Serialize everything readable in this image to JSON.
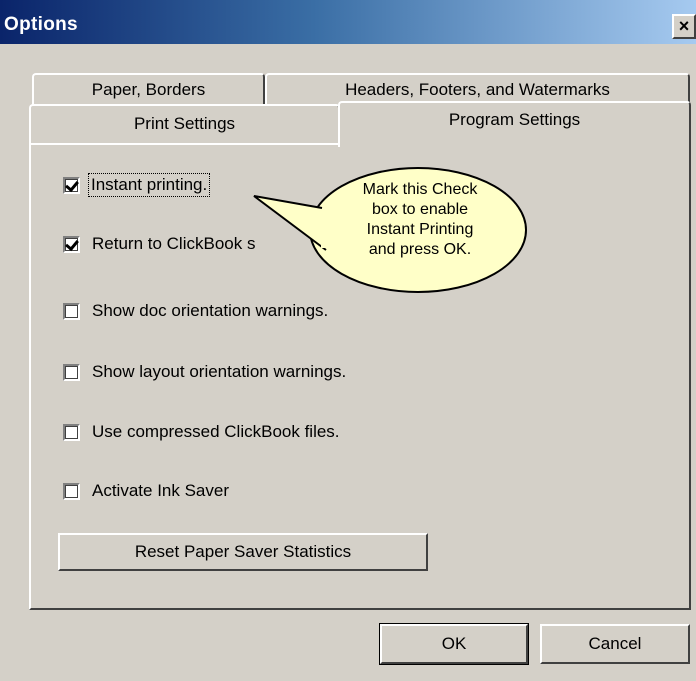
{
  "window": {
    "title": "Options",
    "close_glyph": "×"
  },
  "tabs": {
    "row_back": [
      "Paper, Borders",
      "Headers, Footers, and Watermarks"
    ],
    "row_front": [
      "Print Settings",
      "Program Settings"
    ],
    "active": "Program Settings"
  },
  "options": [
    {
      "label": "Instant printing.",
      "checked": true
    },
    {
      "label": "Return to ClickBook s",
      "checked": true
    },
    {
      "label": "Show doc orientation warnings.",
      "checked": false
    },
    {
      "label": "Show layout orientation warnings.",
      "checked": false
    },
    {
      "label": "Use compressed ClickBook files.",
      "checked": false
    },
    {
      "label": "Activate Ink Saver",
      "checked": false
    }
  ],
  "reset_button": "Reset Paper Saver Statistics",
  "buttons": {
    "ok": "OK",
    "cancel": "Cancel"
  },
  "callout": {
    "line1": "Mark this Check",
    "line2": "box to enable",
    "line3": "Instant Printing",
    "line4": "and press OK."
  },
  "colors": {
    "face": "#d4d0c8",
    "title_start": "#0a246a",
    "title_end": "#a6caf0",
    "callout_fill": "#ffffc8"
  }
}
